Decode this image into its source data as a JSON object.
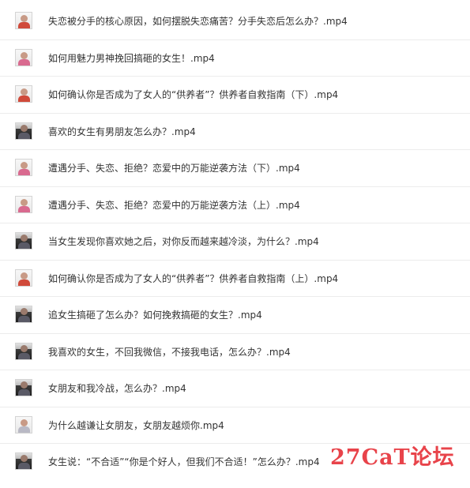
{
  "files": [
    {
      "name": "失恋被分手的核心原因，如何摆脱失恋痛苦？分手失恋后怎么办？.mp4",
      "thumb": "light",
      "accent": "red"
    },
    {
      "name": "如何用魅力男神挽回搞砸的女生！.mp4",
      "thumb": "light",
      "accent": "pink"
    },
    {
      "name": "如何确认你是否成为了女人的“供养者”？供养者自救指南（下）.mp4",
      "thumb": "light",
      "accent": "red"
    },
    {
      "name": "喜欢的女生有男朋友怎么办？.mp4",
      "thumb": "dark",
      "accent": "none"
    },
    {
      "name": "遭遇分手、失恋、拒绝？恋爱中的万能逆袭方法（下）.mp4",
      "thumb": "light",
      "accent": "pink"
    },
    {
      "name": "遭遇分手、失恋、拒绝？恋爱中的万能逆袭方法（上）.mp4",
      "thumb": "light",
      "accent": "pink"
    },
    {
      "name": "当女生发现你喜欢她之后，对你反而越来越冷淡，为什么？.mp4",
      "thumb": "dark",
      "accent": "none"
    },
    {
      "name": "如何确认你是否成为了女人的“供养者”？供养者自救指南（上）.mp4",
      "thumb": "light",
      "accent": "red"
    },
    {
      "name": "追女生搞砸了怎么办？如何挽救搞砸的女生？.mp4",
      "thumb": "dark",
      "accent": "none"
    },
    {
      "name": "我喜欢的女生，不回我微信，不接我电话，怎么办？.mp4",
      "thumb": "dark",
      "accent": "none"
    },
    {
      "name": "女朋友和我冷战，怎么办？.mp4",
      "thumb": "dark",
      "accent": "none"
    },
    {
      "name": "为什么越谦让女朋友，女朋友越烦你.mp4",
      "thumb": "light",
      "accent": "none"
    },
    {
      "name": "女生说：“不合适”“你是个好人，但我们不合适！”怎么办？.mp4",
      "thumb": "dark",
      "accent": "none"
    }
  ],
  "watermark": "27CaT论坛",
  "colors": {
    "text": "#333333",
    "divider": "#ececec",
    "watermark": "#e8434a"
  }
}
